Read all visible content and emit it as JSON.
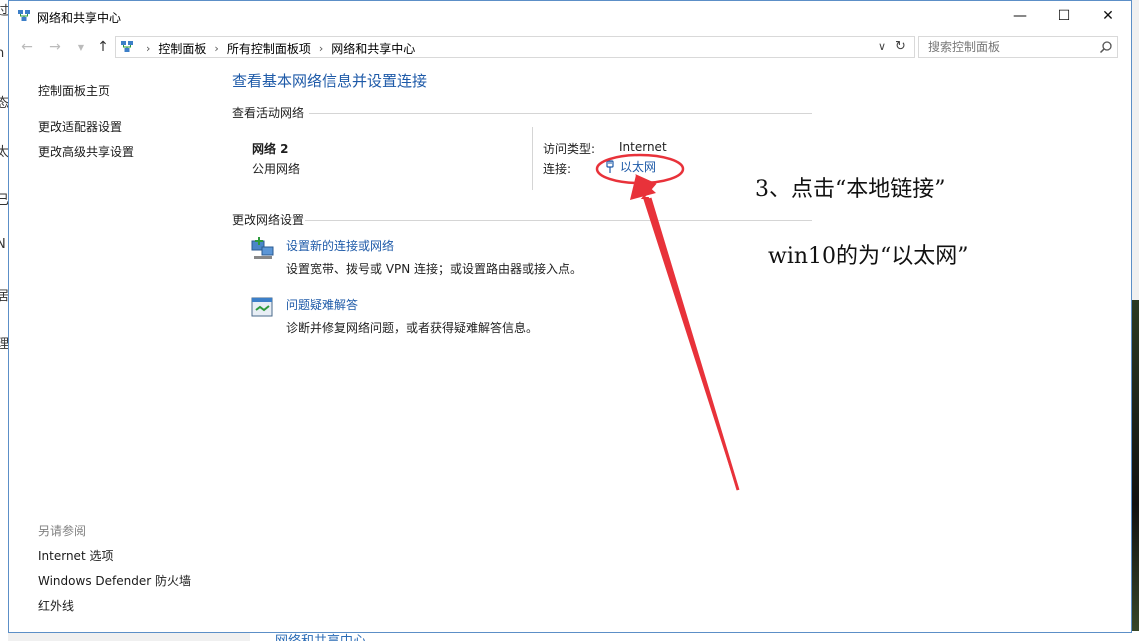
{
  "window": {
    "title": "网络和共享中心",
    "controls": {
      "minimize": "—",
      "maximize": "☐",
      "close": "✕"
    }
  },
  "address_bar": {
    "breadcrumbs": [
      "控制面板",
      "所有控制面板项",
      "网络和共享中心"
    ],
    "search_placeholder": "搜索控制面板"
  },
  "sidebar": {
    "top_links": [
      "控制面板主页",
      "更改适配器设置",
      "更改高级共享设置"
    ],
    "see_also_heading": "另请参阅",
    "see_also_links": [
      "Internet 选项",
      "Windows Defender 防火墙",
      "红外线"
    ]
  },
  "main": {
    "title": "查看基本网络信息并设置连接",
    "active_networks_heading": "查看活动网络",
    "network": {
      "name": "网络 2",
      "type": "公用网络",
      "access_type_label": "访问类型:",
      "access_type_value": "Internet",
      "connections_label": "连接:",
      "connection_name": "以太网"
    },
    "change_settings_heading": "更改网络设置",
    "tasks": [
      {
        "link": "设置新的连接或网络",
        "description": "设置宽带、拨号或 VPN 连接；或设置路由器或接入点。",
        "icon": "network-setup-icon"
      },
      {
        "link": "问题疑难解答",
        "description": "诊断并修复网络问题，或者获得疑难解答信息。",
        "icon": "troubleshoot-icon"
      }
    ]
  },
  "annotation": {
    "line1": "3、点击“本地链接”",
    "line2": "win10的为“以太网”",
    "color": "#e8323a"
  },
  "background": {
    "left_edge_chars": [
      "过",
      "n",
      "态",
      "太",
      "已",
      "N",
      "居",
      "理"
    ],
    "bottom_peek_text": "网络和共享中心"
  }
}
